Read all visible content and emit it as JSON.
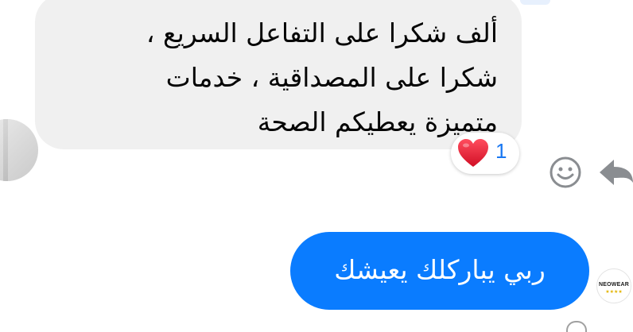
{
  "conversation": {
    "incoming_message": {
      "lines": [
        "ألف شكرا على التفاعل السريع ،",
        "شكرا على المصداقية ، خدمات",
        "متميزة يعطيكم الصحة"
      ],
      "text": "ألف شكرا على التفاعل السريع ،\nشكرا على المصداقية ، خدمات\nمتميزة يعطيكم الصحة"
    },
    "reaction": {
      "icon": "heart-icon",
      "count": "1",
      "color": "#f02849"
    },
    "actions": {
      "react_icon": "smile-icon",
      "reply_icon": "reply-arrow-icon"
    },
    "outgoing_message": {
      "text": "ربي يباركلك يعيشك"
    },
    "sender_avatar": {
      "brand": "NEOWEAR",
      "stars": "★★★★"
    }
  },
  "colors": {
    "incoming_bubble": "#f0f0f0",
    "outgoing_bubble": "#0a7cff",
    "reaction_count": "#1877f2"
  }
}
